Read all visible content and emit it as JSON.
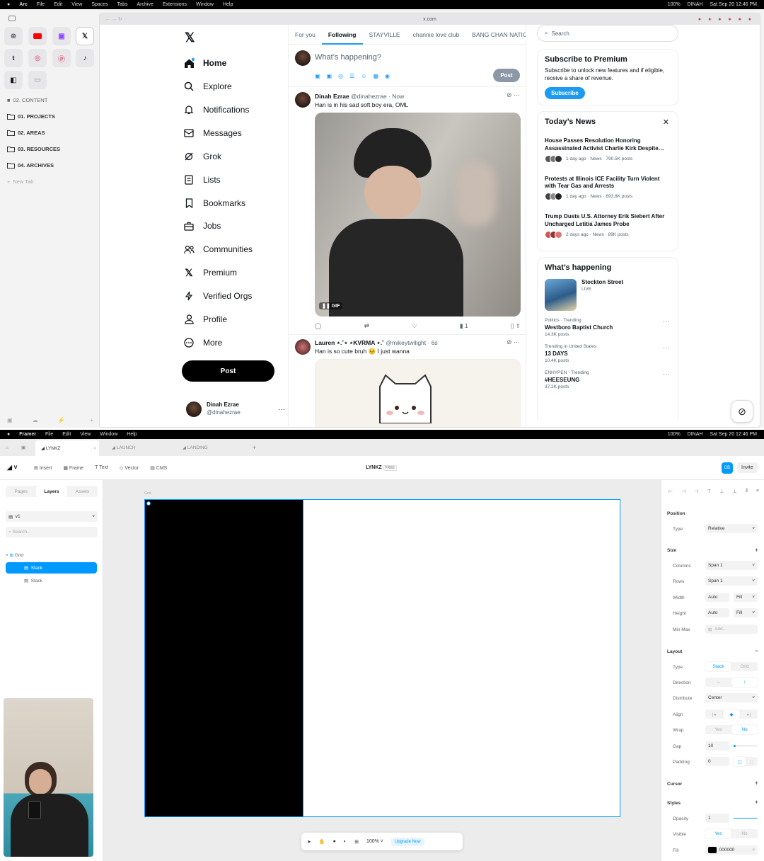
{
  "arc_menubar": {
    "items": [
      "Arc",
      "File",
      "Edit",
      "View",
      "Spaces",
      "Tabs",
      "Archive",
      "Extensions",
      "Window",
      "Help"
    ],
    "right": [
      "100%",
      "DINAH",
      "Sat Sep 20  12:46 PM"
    ]
  },
  "arc": {
    "url": "x.com",
    "sidebar": {
      "content_label": "02. CONTENT",
      "folders": [
        "01. PROJECTS",
        "02. AREAS",
        "03. RESOURCES",
        "04. ARCHIVES"
      ],
      "new_tab": "New Tab"
    }
  },
  "x": {
    "nav": [
      "Home",
      "Explore",
      "Notifications",
      "Messages",
      "Grok",
      "Lists",
      "Bookmarks",
      "Jobs",
      "Communities",
      "Premium",
      "Verified Orgs",
      "Profile",
      "More"
    ],
    "post_button": "Post",
    "account": {
      "name": "Dinah Ezrae",
      "handle": "@dinahezrae"
    },
    "tabs": [
      "For you",
      "Following",
      "STAYVILLE",
      "channie love club",
      "BANG CHAN NATIC"
    ],
    "composer_placeholder": "What’s happening?",
    "composer_post": "Post",
    "tweets": [
      {
        "name": "Dinah Ezrae",
        "meta": "@dinahezrae · Now",
        "text": "Han is in his sad soft boy era, OML",
        "gif": "GIF",
        "views": "1"
      },
      {
        "name": "Lauren ⋆.˚⋆ ⋆KVRMA ⋆.˚",
        "meta": "@mikeytwilight · 6s",
        "text": "Han is so cute bruh 😣 I just wanna"
      }
    ],
    "search_placeholder": "Search",
    "premium": {
      "title": "Subscribe to Premium",
      "body": "Subscribe to unlock new features and if eligible, receive a share of revenue.",
      "button": "Subscribe"
    },
    "news": {
      "title": "Today’s News",
      "items": [
        {
          "title": "House Passes Resolution Honoring Assassinated Activist Charlie Kirk Despite…",
          "meta": "1 day ago · News · 790.5K posts"
        },
        {
          "title": "Protests at Illinois ICE Facility Turn Violent with Tear Gas and Arrests",
          "meta": "1 day ago · News · 693.8K posts"
        },
        {
          "title": "Trump Ousts U.S. Attorney Erik Siebert After Uncharged Letitia James Probe",
          "meta": "2 days ago · News · 89K posts"
        }
      ]
    },
    "happening": {
      "title": "What’s happening",
      "live": {
        "title": "Stockton Street",
        "status": "LIVE"
      },
      "trends": [
        {
          "context": "Politics · Trending",
          "title": "Westboro Baptist Church",
          "count": "14.3K posts"
        },
        {
          "context": "Trending in United States",
          "title": "13 DAYS",
          "count": "10.4K posts"
        },
        {
          "context": "ENHYPEN · Trending",
          "title": "#HEESEUNG",
          "count": "37.2K posts"
        }
      ]
    }
  },
  "framer_menubar": {
    "items": [
      "Framer",
      "File",
      "Edit",
      "View",
      "Window",
      "Help"
    ],
    "right": [
      "100%",
      "DINAH",
      "Sat Sep 20  12:46 PM"
    ]
  },
  "framer": {
    "tabs": [
      "LYNKZ",
      "LAUNCH",
      "LANDING"
    ],
    "tools": [
      "Insert",
      "Frame",
      "Text",
      "Vector",
      "CMS"
    ],
    "project": "LYNKZ",
    "plan": "FREE",
    "avatar": "DB",
    "invite": "Invite",
    "panel_tabs": [
      "Pages",
      "Layers",
      "Assets"
    ],
    "version": "v1",
    "search_placeholder": "Search...",
    "layers": [
      "Grid",
      "Stack",
      "Stack"
    ],
    "canvas_label": "Grid",
    "zoom": "100%",
    "upgrade": "Upgrade Now",
    "props": {
      "position": "Position",
      "type_label": "Type",
      "type": "Relative",
      "size": "Size",
      "columns_label": "Columns",
      "columns": "Span 1",
      "rows_label": "Rows",
      "rows": "Span 1",
      "width_label": "Width",
      "width": "Auto",
      "width_mode": "Fill",
      "height_label": "Height",
      "height": "Auto",
      "height_mode": "Fill",
      "minmax_label": "Min Max",
      "minmax": "Add...",
      "layout": "Layout",
      "layout_type_label": "Type",
      "layout_types": [
        "Stack",
        "Grid"
      ],
      "direction_label": "Direction",
      "distribute_label": "Distribute",
      "distribute": "Center",
      "align_label": "Align",
      "wrap_label": "Wrap",
      "wrap": [
        "Yes",
        "No"
      ],
      "gap_label": "Gap",
      "gap": "10",
      "padding_label": "Padding",
      "padding": "0",
      "cursor": "Cursor",
      "styles": "Styles",
      "opacity_label": "Opacity",
      "opacity": "1",
      "visible_label": "Visible",
      "visible": [
        "Yes",
        "No"
      ],
      "fill_label": "Fill",
      "fill": "000000"
    }
  }
}
